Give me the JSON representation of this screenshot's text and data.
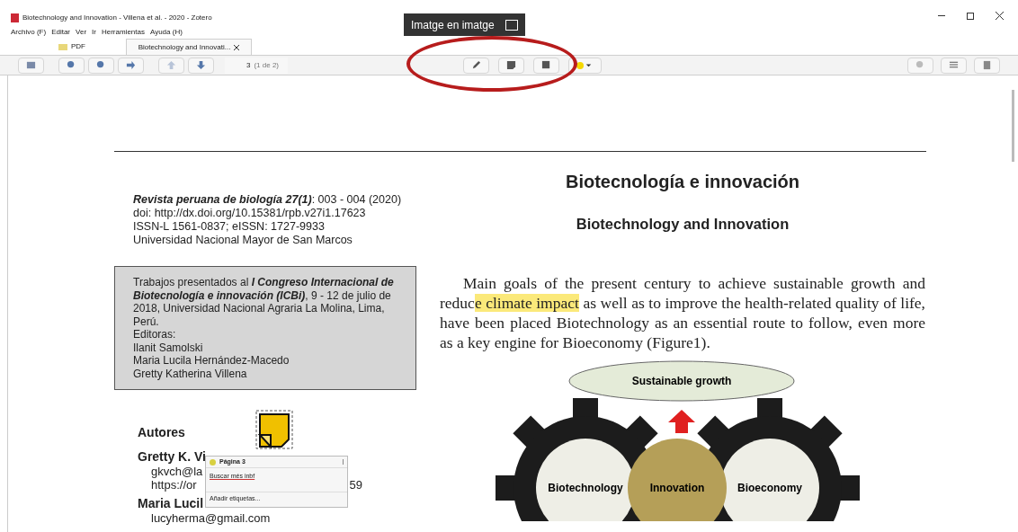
{
  "window": {
    "title": "Biotechnology and Innovation - Villena et al. - 2020 - Zotero"
  },
  "menu": [
    "Archivo (F)",
    "Editar",
    "Ver",
    "Ir",
    "Herramientas",
    "Ayuda (H)"
  ],
  "tabs": [
    {
      "label": "PDF",
      "selected": false
    },
    {
      "label": "Biotechnology and Innovati...",
      "selected": true
    }
  ],
  "toolbar": {
    "page": "3",
    "page_count": "(1 de 2)"
  },
  "overlay_tooltip": "Imatge en imatge",
  "document": {
    "journal": [
      "**Revista peruana de biología 27(1)**: 003 - 004 (2020)",
      "doi: http://dx.doi.org/10.15381/rpb.v27i1.17623",
      "ISSN-L 1561-0837; eISSN: 1727-9933",
      "Universidad Nacional Mayor de San Marcos"
    ],
    "congress": "Trabajos presentados al **I Congreso Internacional de Biotecnología e innovación (ICBi)**, 9 - 12 de julio de 2018, Universidad Nacional Agraria La Molina, Lima, Perú.",
    "editors_label": "Editoras:",
    "editors": [
      "Ilanit Samolski",
      "Maria Lucila Hernández-Macedo",
      "Gretty Katherina Villena"
    ],
    "title": "Biotecnología e innovación",
    "subtitle": "Biotechnology and Innovation",
    "paragraph": {
      "before": "Main goals of the present century to achieve sustainable growth and reduc",
      "highlight": "e climate impact",
      "after": " as well as to improve the health-related quality of life, have been placed Biotechnology as an essential route to follow, even more as a key engine for Bioeconomy (Figure1)."
    },
    "authors_heading": "Autores",
    "authors": [
      {
        "kind": "name",
        "parts": [
          "Gretty K. Vi"
        ]
      },
      {
        "kind": "line",
        "parts": [
          "gkvch@la"
        ]
      },
      {
        "kind": "line",
        "parts": [
          "https://or",
          "59"
        ]
      },
      {
        "kind": "name",
        "parts": [
          "Maria Lucil"
        ]
      },
      {
        "kind": "line",
        "parts": [
          "lucyherma@gmail.com"
        ]
      }
    ],
    "figure": {
      "goal": "Sustainable growth",
      "left": "Biotechnology",
      "center": "Innovation",
      "right": "Bioeconomy"
    }
  },
  "note_popup": {
    "title": "Página 3",
    "text": "Buscar més inbf",
    "tags": "Añadir etiquetas..."
  }
}
